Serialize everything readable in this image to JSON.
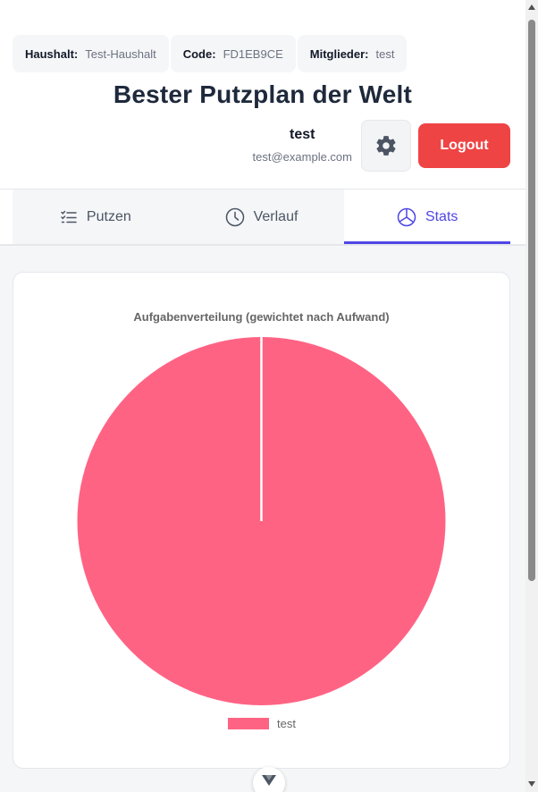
{
  "header": {
    "chips": [
      {
        "key": "Haushalt:",
        "value": "Test-Haushalt"
      },
      {
        "key": "Code:",
        "value": "FD1EB9CE"
      },
      {
        "key": "Mitglieder:",
        "value": "test"
      }
    ],
    "title": "Bester Putzplan der Welt",
    "user": {
      "name": "test",
      "email": "test@example.com"
    },
    "settings_icon": "gear-icon",
    "logout_label": "Logout"
  },
  "tabs": [
    {
      "label": "Putzen",
      "icon": "checklist-icon",
      "active": false
    },
    {
      "label": "Verlauf",
      "icon": "clock-icon",
      "active": false
    },
    {
      "label": "Stats",
      "icon": "pie-chart-icon",
      "active": true
    }
  ],
  "colors": {
    "accent": "#4f46e5",
    "logout": "#ef4444",
    "slice": "#ff6384"
  },
  "chart_data": {
    "type": "pie",
    "title": "Aufgabenverteilung (gewichtet nach Aufwand)",
    "categories": [
      "test"
    ],
    "values": [
      100
    ],
    "colors": [
      "#ff6384"
    ],
    "legend": "bottom"
  }
}
